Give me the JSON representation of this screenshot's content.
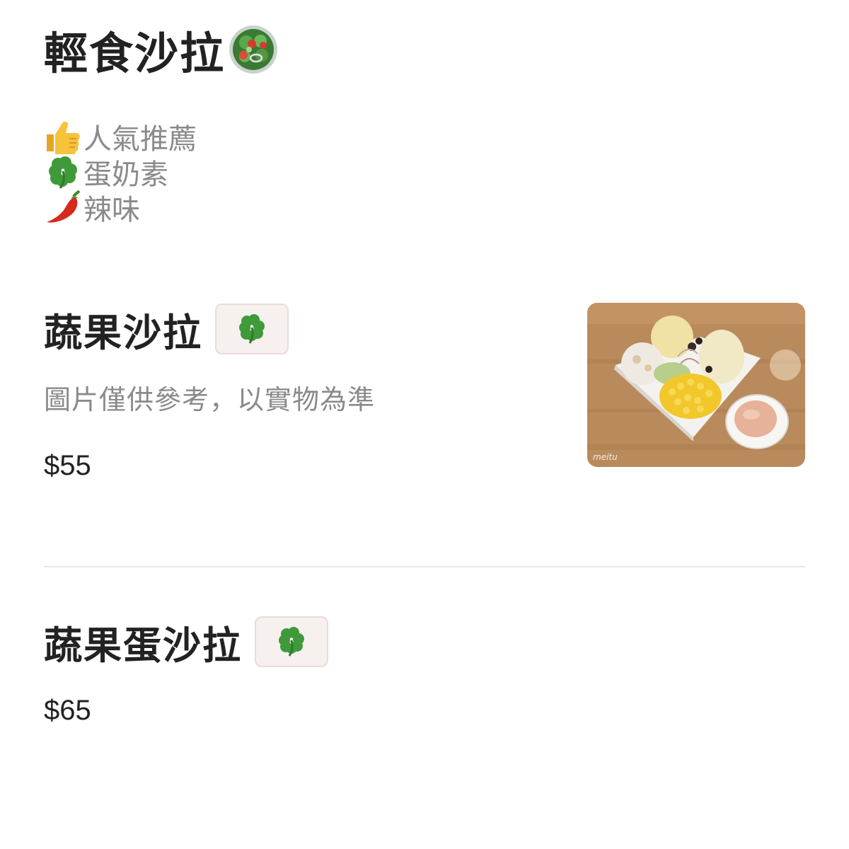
{
  "category": {
    "title": "輕食沙拉",
    "title_icon": "salad-bowl-icon"
  },
  "legend": [
    {
      "icon": "thumbs-up-icon",
      "label": "人氣推薦"
    },
    {
      "icon": "four-leaf-clover-icon",
      "label": "蛋奶素"
    },
    {
      "icon": "chili-pepper-icon",
      "label": "辣味"
    }
  ],
  "items": [
    {
      "name": "蔬果沙拉",
      "badge_icon": "four-leaf-clover-icon",
      "description": "圖片僅供參考，以實物為準",
      "price": "$55",
      "has_photo": true,
      "photo_watermark": "meitu"
    },
    {
      "name": "蔬果蛋沙拉",
      "badge_icon": "four-leaf-clover-icon",
      "price": "$65",
      "has_photo": false
    }
  ],
  "colors": {
    "text_primary": "#222222",
    "text_secondary": "#8a8a8a",
    "badge_bg": "#f6f1ef",
    "badge_border": "#e8dcd8",
    "divider": "#e6e6e6",
    "clover_green": "#3f9a3a"
  }
}
